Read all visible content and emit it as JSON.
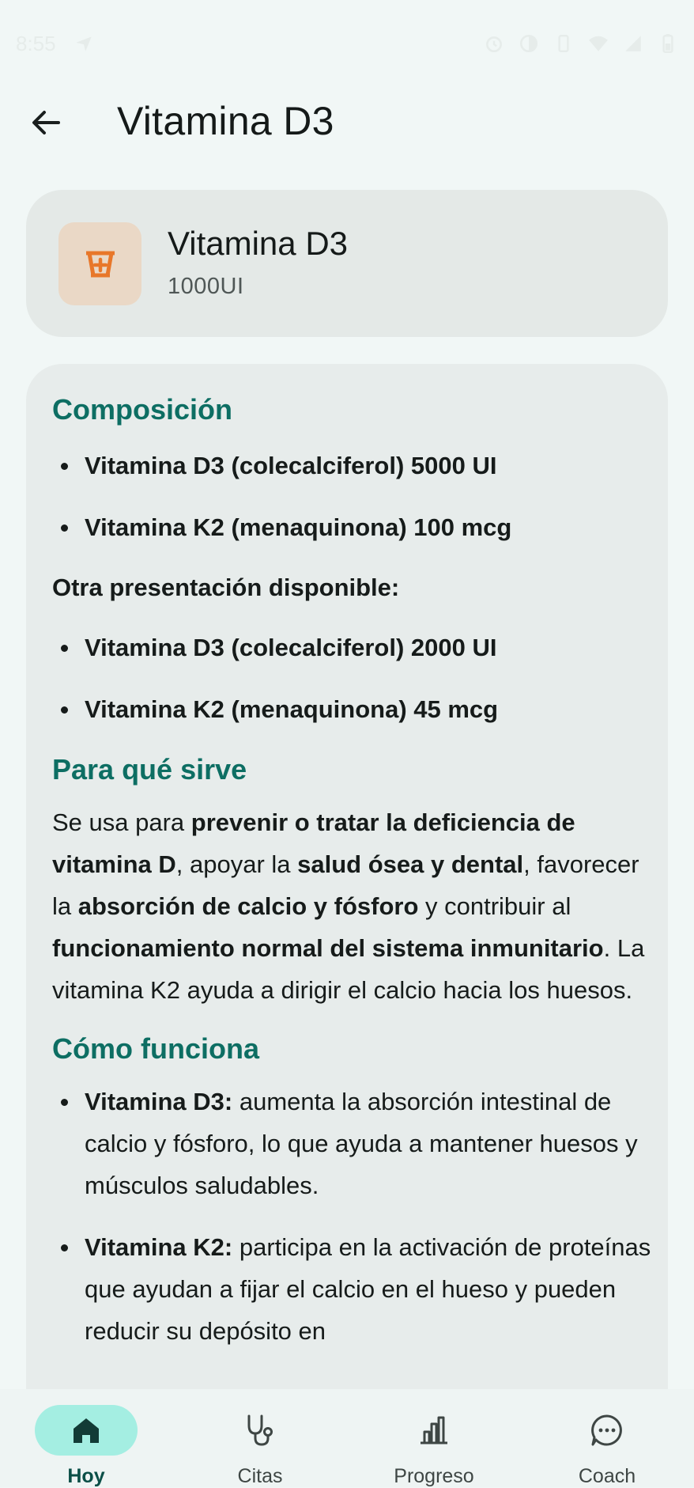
{
  "status_bar": {
    "time": "8:55"
  },
  "app_bar": {
    "title": "Vitamina D3"
  },
  "medication": {
    "name": "Vitamina D3",
    "dose": "1000UI",
    "icon": "mortar-pestle-plus-icon",
    "accent": "#e8772a"
  },
  "composition": {
    "heading": "Composición",
    "items": [
      "Vitamina D3 (colecalciferol) 5000 UI",
      "Vitamina K2 (menaquinona) 100 mcg"
    ],
    "alt_heading": "Otra presentación disponible:",
    "alt_items": [
      "Vitamina D3 (colecalciferol) 2000 UI",
      "Vitamina K2 (menaquinona) 45 mcg"
    ]
  },
  "purpose": {
    "heading": "Para qué sirve",
    "p1": "Se usa para ",
    "b1": "prevenir o tratar la deficiencia de vitamina D",
    "p2": ", apoyar la ",
    "b2": "salud ósea y dental",
    "p3": ", favorecer la ",
    "b3": "absorción de calcio y fósforo",
    "p4": " y contribuir al ",
    "b4": "funcionamiento normal del sistema inmunitario",
    "p5": ". La vitamina K2 ayuda a dirigir el calcio hacia los huesos."
  },
  "how": {
    "heading": "Cómo funciona",
    "items": [
      {
        "term": "Vitamina D3:",
        "text": " aumenta la absorción intestinal de calcio y fósforo, lo que ayuda a mantener huesos y músculos saludables."
      },
      {
        "term": "Vitamina K2:",
        "text": " participa en la activación de proteínas que ayudan a fijar el calcio en el hueso y pueden reducir su depósito en"
      }
    ]
  },
  "nav": {
    "items": [
      {
        "label": "Hoy",
        "icon": "home-icon",
        "active": true
      },
      {
        "label": "Citas",
        "icon": "stethoscope-icon",
        "active": false
      },
      {
        "label": "Progreso",
        "icon": "bar-chart-icon",
        "active": false
      },
      {
        "label": "Coach",
        "icon": "chat-bubble-icon",
        "active": false
      }
    ]
  },
  "colors": {
    "section_heading": "#0d6e63",
    "nav_active_pill": "#a4eee2"
  }
}
